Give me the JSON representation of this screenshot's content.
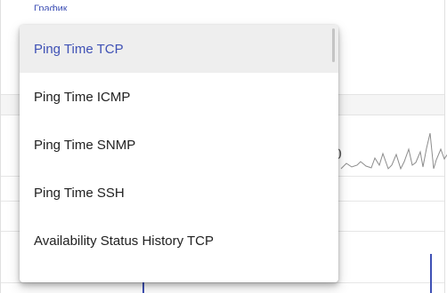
{
  "field": {
    "label": "График"
  },
  "chart": {
    "visible_tick": "0"
  },
  "dropdown": {
    "selected_index": 0,
    "options": [
      "Ping Time TCP",
      "Ping Time ICMP",
      "Ping Time SNMP",
      "Ping Time SSH",
      "Availability Status History TCP"
    ]
  },
  "colors": {
    "accent": "#3f51b5",
    "selected_background": "#eeeeee",
    "series_line": "#8c8c8c",
    "spike_line": "#3f51b5"
  }
}
